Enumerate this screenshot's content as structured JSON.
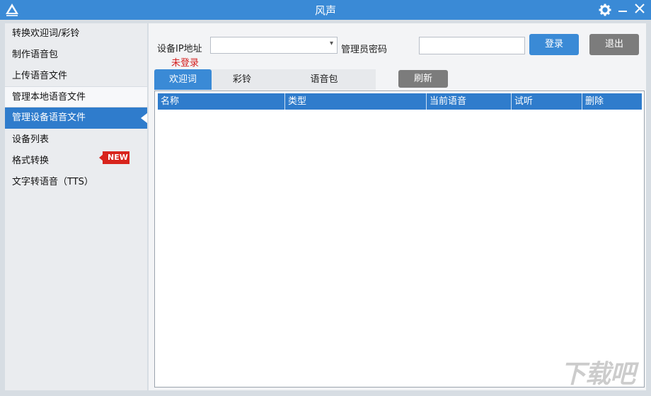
{
  "window": {
    "title": "风声",
    "logo_icon": "logo-triangle-icon",
    "controls": [
      "gear-icon",
      "minimize-icon",
      "close-icon"
    ]
  },
  "sidebar": {
    "items": [
      {
        "label": "转换欢迎词/彩铃"
      },
      {
        "label": "制作语音包"
      },
      {
        "label": "上传语音文件"
      },
      {
        "label": "管理本地语音文件"
      },
      {
        "label": "管理设备语音文件"
      },
      {
        "label": "设备列表"
      },
      {
        "label": "格式转换"
      },
      {
        "label": "文字转语音（TTS）"
      }
    ],
    "active_index": 4,
    "new_badge": "NEW"
  },
  "form": {
    "ip_label": "设备IP地址",
    "ip_value": "",
    "status_text": "未登录",
    "password_label": "管理员密码",
    "password_value": "",
    "login_button": "登录",
    "exit_button": "退出"
  },
  "tabs": {
    "items": [
      {
        "label": "欢迎词"
      },
      {
        "label": "彩铃"
      },
      {
        "label": "语音包"
      }
    ],
    "active_index": 0,
    "refresh_button": "刷新"
  },
  "table": {
    "columns": [
      "名称",
      "类型",
      "当前语音",
      "试听",
      "删除"
    ],
    "rows": []
  },
  "colors": {
    "accent": "#3a8ad6",
    "header": "#2f7ccc",
    "status_red": "#d42020",
    "button_gray": "#7c7c7c",
    "badge_red": "#d8241c"
  },
  "watermark": "下载吧"
}
